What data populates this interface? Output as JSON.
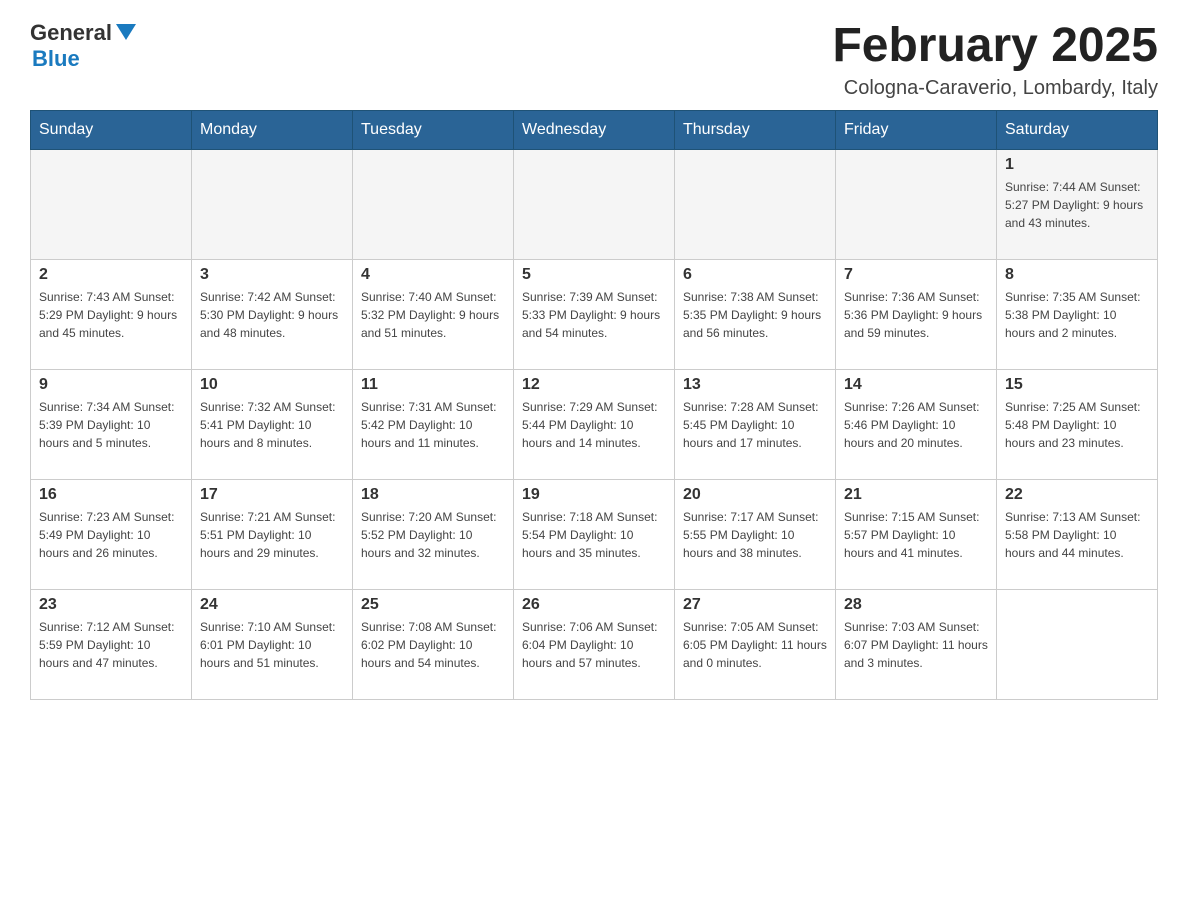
{
  "header": {
    "logo": {
      "text_general": "General",
      "text_blue": "Blue"
    },
    "title": "February 2025",
    "subtitle": "Cologna-Caraverio, Lombardy, Italy"
  },
  "weekdays": [
    "Sunday",
    "Monday",
    "Tuesday",
    "Wednesday",
    "Thursday",
    "Friday",
    "Saturday"
  ],
  "weeks": [
    [
      {
        "day": "",
        "info": ""
      },
      {
        "day": "",
        "info": ""
      },
      {
        "day": "",
        "info": ""
      },
      {
        "day": "",
        "info": ""
      },
      {
        "day": "",
        "info": ""
      },
      {
        "day": "",
        "info": ""
      },
      {
        "day": "1",
        "info": "Sunrise: 7:44 AM\nSunset: 5:27 PM\nDaylight: 9 hours\nand 43 minutes."
      }
    ],
    [
      {
        "day": "2",
        "info": "Sunrise: 7:43 AM\nSunset: 5:29 PM\nDaylight: 9 hours\nand 45 minutes."
      },
      {
        "day": "3",
        "info": "Sunrise: 7:42 AM\nSunset: 5:30 PM\nDaylight: 9 hours\nand 48 minutes."
      },
      {
        "day": "4",
        "info": "Sunrise: 7:40 AM\nSunset: 5:32 PM\nDaylight: 9 hours\nand 51 minutes."
      },
      {
        "day": "5",
        "info": "Sunrise: 7:39 AM\nSunset: 5:33 PM\nDaylight: 9 hours\nand 54 minutes."
      },
      {
        "day": "6",
        "info": "Sunrise: 7:38 AM\nSunset: 5:35 PM\nDaylight: 9 hours\nand 56 minutes."
      },
      {
        "day": "7",
        "info": "Sunrise: 7:36 AM\nSunset: 5:36 PM\nDaylight: 9 hours\nand 59 minutes."
      },
      {
        "day": "8",
        "info": "Sunrise: 7:35 AM\nSunset: 5:38 PM\nDaylight: 10 hours\nand 2 minutes."
      }
    ],
    [
      {
        "day": "9",
        "info": "Sunrise: 7:34 AM\nSunset: 5:39 PM\nDaylight: 10 hours\nand 5 minutes."
      },
      {
        "day": "10",
        "info": "Sunrise: 7:32 AM\nSunset: 5:41 PM\nDaylight: 10 hours\nand 8 minutes."
      },
      {
        "day": "11",
        "info": "Sunrise: 7:31 AM\nSunset: 5:42 PM\nDaylight: 10 hours\nand 11 minutes."
      },
      {
        "day": "12",
        "info": "Sunrise: 7:29 AM\nSunset: 5:44 PM\nDaylight: 10 hours\nand 14 minutes."
      },
      {
        "day": "13",
        "info": "Sunrise: 7:28 AM\nSunset: 5:45 PM\nDaylight: 10 hours\nand 17 minutes."
      },
      {
        "day": "14",
        "info": "Sunrise: 7:26 AM\nSunset: 5:46 PM\nDaylight: 10 hours\nand 20 minutes."
      },
      {
        "day": "15",
        "info": "Sunrise: 7:25 AM\nSunset: 5:48 PM\nDaylight: 10 hours\nand 23 minutes."
      }
    ],
    [
      {
        "day": "16",
        "info": "Sunrise: 7:23 AM\nSunset: 5:49 PM\nDaylight: 10 hours\nand 26 minutes."
      },
      {
        "day": "17",
        "info": "Sunrise: 7:21 AM\nSunset: 5:51 PM\nDaylight: 10 hours\nand 29 minutes."
      },
      {
        "day": "18",
        "info": "Sunrise: 7:20 AM\nSunset: 5:52 PM\nDaylight: 10 hours\nand 32 minutes."
      },
      {
        "day": "19",
        "info": "Sunrise: 7:18 AM\nSunset: 5:54 PM\nDaylight: 10 hours\nand 35 minutes."
      },
      {
        "day": "20",
        "info": "Sunrise: 7:17 AM\nSunset: 5:55 PM\nDaylight: 10 hours\nand 38 minutes."
      },
      {
        "day": "21",
        "info": "Sunrise: 7:15 AM\nSunset: 5:57 PM\nDaylight: 10 hours\nand 41 minutes."
      },
      {
        "day": "22",
        "info": "Sunrise: 7:13 AM\nSunset: 5:58 PM\nDaylight: 10 hours\nand 44 minutes."
      }
    ],
    [
      {
        "day": "23",
        "info": "Sunrise: 7:12 AM\nSunset: 5:59 PM\nDaylight: 10 hours\nand 47 minutes."
      },
      {
        "day": "24",
        "info": "Sunrise: 7:10 AM\nSunset: 6:01 PM\nDaylight: 10 hours\nand 51 minutes."
      },
      {
        "day": "25",
        "info": "Sunrise: 7:08 AM\nSunset: 6:02 PM\nDaylight: 10 hours\nand 54 minutes."
      },
      {
        "day": "26",
        "info": "Sunrise: 7:06 AM\nSunset: 6:04 PM\nDaylight: 10 hours\nand 57 minutes."
      },
      {
        "day": "27",
        "info": "Sunrise: 7:05 AM\nSunset: 6:05 PM\nDaylight: 11 hours\nand 0 minutes."
      },
      {
        "day": "28",
        "info": "Sunrise: 7:03 AM\nSunset: 6:07 PM\nDaylight: 11 hours\nand 3 minutes."
      },
      {
        "day": "",
        "info": ""
      }
    ]
  ]
}
